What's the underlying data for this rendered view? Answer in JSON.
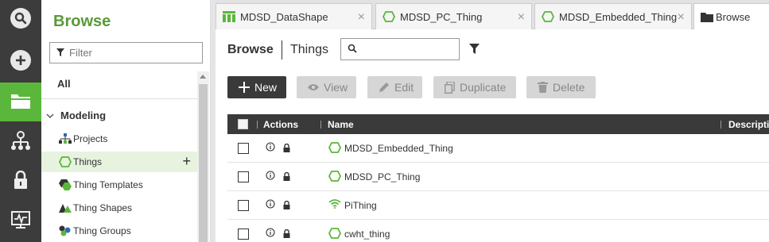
{
  "sidebar": {
    "title": "Browse",
    "filter_placeholder": "Filter",
    "all_label": "All",
    "section_label": "Modeling",
    "items": [
      {
        "label": "Projects",
        "icon": "projects-icon"
      },
      {
        "label": "Things",
        "icon": "thing-hexagon-icon",
        "selected": true
      },
      {
        "label": "Thing Templates",
        "icon": "thing-templates-icon"
      },
      {
        "label": "Thing Shapes",
        "icon": "thing-shapes-icon"
      },
      {
        "label": "Thing Groups",
        "icon": "thing-groups-icon"
      }
    ]
  },
  "rail": {
    "icons": [
      "search-icon",
      "add-icon",
      "folder-icon",
      "hierarchy-icon",
      "lock-icon",
      "monitor-icon"
    ]
  },
  "tabs": [
    {
      "label": "MDSD_DataShape",
      "icon": "datashape-icon"
    },
    {
      "label": "MDSD_PC_Thing",
      "icon": "thing-hexagon-icon"
    },
    {
      "label": "MDSD_Embedded_Thing",
      "icon": "thing-hexagon-icon"
    },
    {
      "label": "Browse",
      "icon": "folder-icon",
      "active": true
    }
  ],
  "main": {
    "breadcrumb_root": "Browse",
    "breadcrumb_current": "Things",
    "search_value": "",
    "toolbar": {
      "new_label": "New",
      "view_label": "View",
      "edit_label": "Edit",
      "duplicate_label": "Duplicate",
      "delete_label": "Delete"
    },
    "table": {
      "columns": [
        "Actions",
        "Name",
        "Descripti"
      ],
      "rows": [
        {
          "name": "MDSD_Embedded_Thing",
          "icon": "thing-hexagon-icon"
        },
        {
          "name": "MDSD_PC_Thing",
          "icon": "thing-hexagon-icon"
        },
        {
          "name": "PiThing",
          "icon": "wifi-icon"
        },
        {
          "name": "cwht_thing",
          "icon": "thing-hexagon-icon"
        }
      ]
    }
  },
  "colors": {
    "accent_green": "#5bb73b",
    "title_green": "#5a9a3a",
    "dark": "#3a3a3a"
  }
}
